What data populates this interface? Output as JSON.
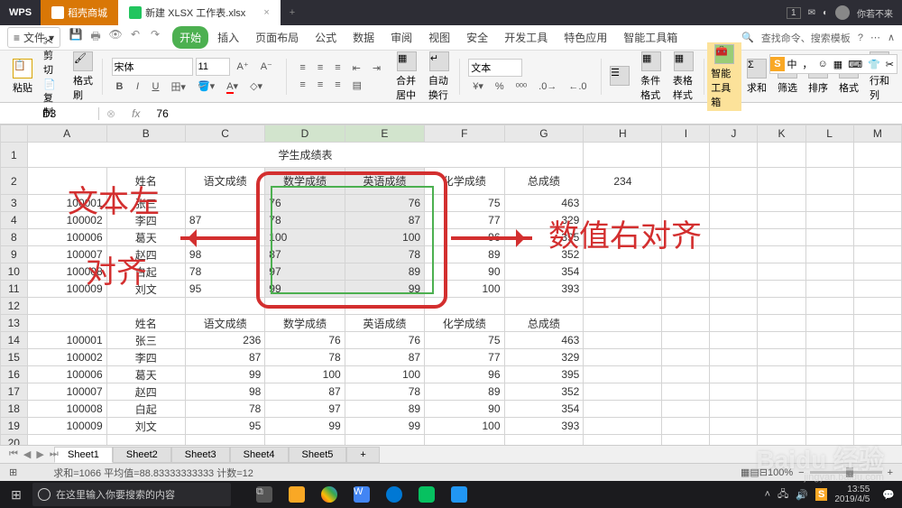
{
  "titlebar": {
    "app": "WPS",
    "tab_store": "稻壳商城",
    "tab_active": "新建 XLSX 工作表.xlsx",
    "badge": "1",
    "user": "你若不来"
  },
  "menu": {
    "file": "文件",
    "tabs": [
      "开始",
      "插入",
      "页面布局",
      "公式",
      "数据",
      "审阅",
      "视图",
      "安全",
      "开发工具",
      "特色应用",
      "智能工具箱"
    ],
    "search": "查找命令、搜索模板"
  },
  "ribbon": {
    "paste": "粘贴",
    "cut": "剪切",
    "copy": "复制",
    "fmtpaint": "格式刷",
    "font": "宋体",
    "size": "11",
    "merge": "合并居中",
    "wrap": "自动换行",
    "numfmt": "文本",
    "condfmt": "条件格式",
    "tblstyle": "表格样式",
    "smart": "智能工具箱",
    "sum": "求和",
    "filter": "筛选",
    "sort": "排序",
    "format": "格式",
    "rowcol": "行和列"
  },
  "ime": {
    "s": "S",
    "zhong": "中",
    "dot": "，",
    "face": "☺",
    "b1": "▦",
    "b2": "⌨",
    "hanger": "👕",
    "gear": "✂"
  },
  "fbar": {
    "name": "D3",
    "fx": "fx",
    "val": "76"
  },
  "cols": [
    "A",
    "B",
    "C",
    "D",
    "E",
    "F",
    "G",
    "H",
    "I",
    "J",
    "K",
    "L",
    "M"
  ],
  "table": {
    "title": "学生成绩表",
    "headers": [
      "",
      "姓名",
      "语文成绩",
      "数学成绩",
      "英语成绩",
      "化学成绩",
      "总成绩",
      "",
      "234"
    ],
    "r3": [
      "100001",
      "张三",
      "",
      "76",
      "76",
      "75",
      "463"
    ],
    "r4": [
      "100002",
      "李四",
      "87",
      "78",
      "87",
      "77",
      "329"
    ],
    "r8": [
      "100006",
      "葛天",
      "",
      "100",
      "100",
      "96",
      "395"
    ],
    "r9": [
      "100007",
      "赵四",
      "98",
      "87",
      "78",
      "89",
      "352"
    ],
    "r10": [
      "100008",
      "白起",
      "78",
      "97",
      "89",
      "90",
      "354"
    ],
    "r11": [
      "100009",
      "刘文",
      "95",
      "99",
      "99",
      "100",
      "393"
    ],
    "h2": [
      "",
      "姓名",
      "语文成绩",
      "数学成绩",
      "英语成绩",
      "化学成绩",
      "总成绩"
    ],
    "r14": [
      "100001",
      "张三",
      "236",
      "76",
      "76",
      "75",
      "463"
    ],
    "r15": [
      "100002",
      "李四",
      "87",
      "78",
      "87",
      "77",
      "329"
    ],
    "r16": [
      "100006",
      "葛天",
      "99",
      "100",
      "100",
      "96",
      "395"
    ],
    "r17": [
      "100007",
      "赵四",
      "98",
      "87",
      "78",
      "89",
      "352"
    ],
    "r18": [
      "100008",
      "白起",
      "78",
      "97",
      "89",
      "90",
      "354"
    ],
    "r19": [
      "100009",
      "刘文",
      "95",
      "99",
      "99",
      "100",
      "393"
    ]
  },
  "anno": {
    "left1": "文本左",
    "left2": "对齐",
    "right": "数值右对齐"
  },
  "sheets": [
    "Sheet1",
    "Sheet2",
    "Sheet3",
    "Sheet4",
    "Sheet5"
  ],
  "status": {
    "stats": "求和=1066  平均值=88.83333333333  计数=12",
    "zoom": "100%"
  },
  "watermark": {
    "main": "Baidu 经验",
    "sub": "jingyan.baidu.com"
  },
  "taskbar": {
    "search": "在这里输入你要搜索的内容",
    "time": "13:55",
    "date": "2019/4/5"
  }
}
